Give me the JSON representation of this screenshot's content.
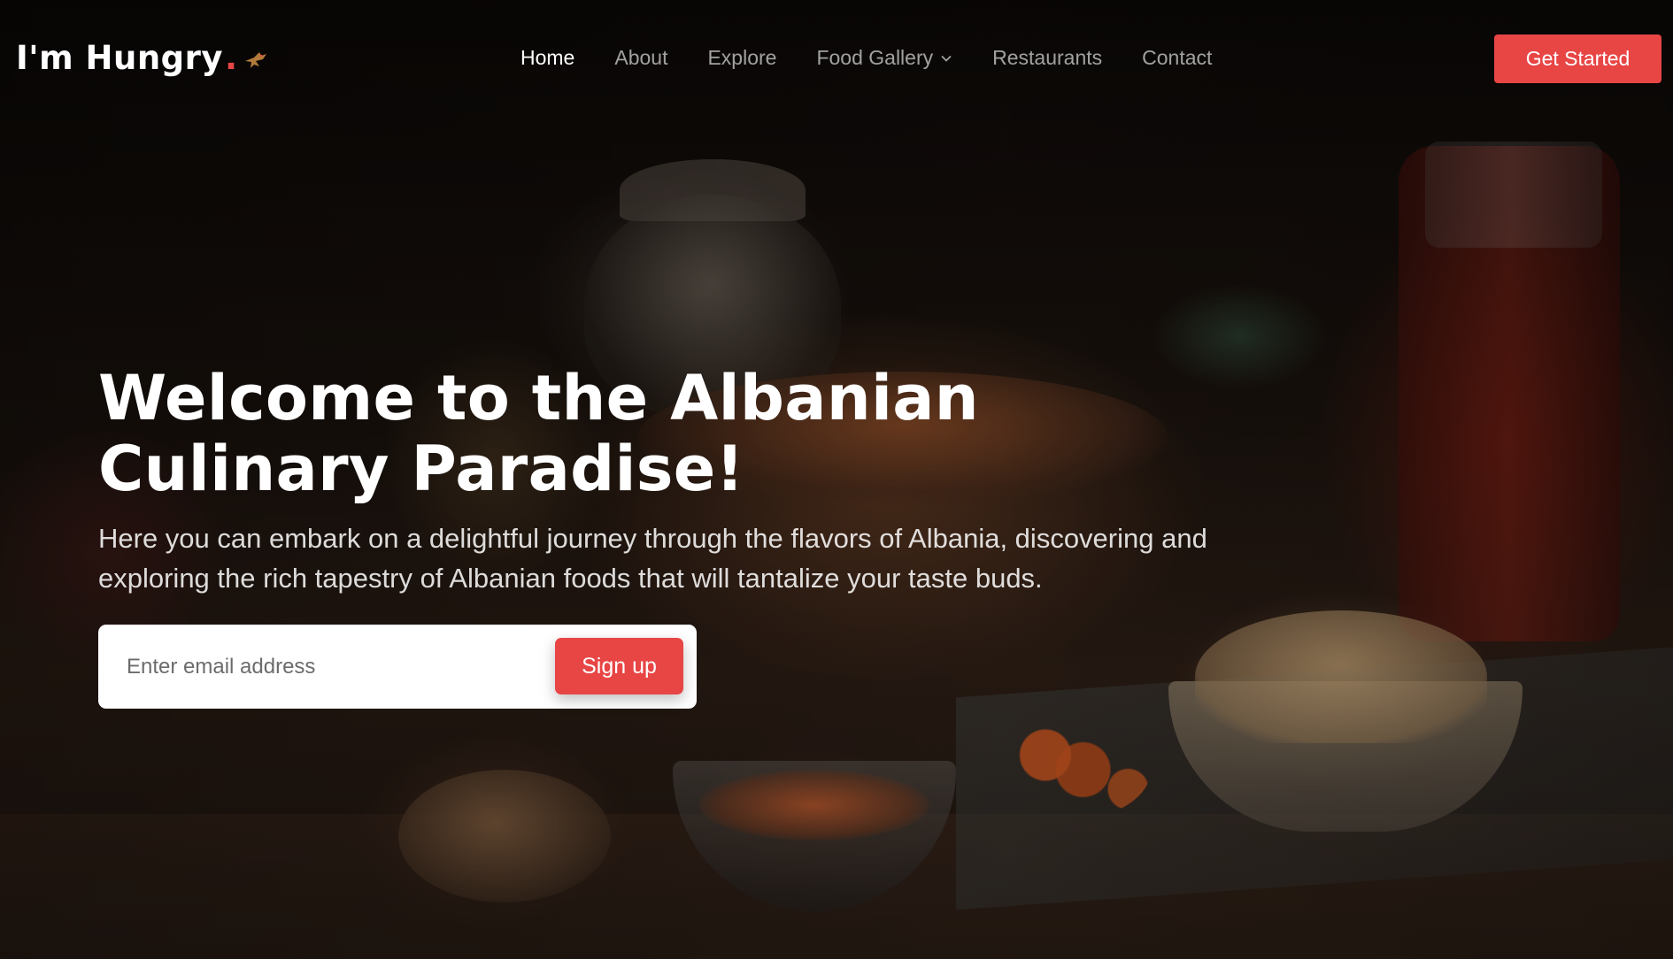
{
  "brand": {
    "name": "I'm Hungry",
    "dot": ".",
    "icon": "bird-icon",
    "accent_color": "#e84545"
  },
  "nav": {
    "items": [
      {
        "label": "Home",
        "active": true
      },
      {
        "label": "About",
        "active": false
      },
      {
        "label": "Explore",
        "active": false
      },
      {
        "label": "Food Gallery",
        "active": false,
        "dropdown": true
      },
      {
        "label": "Restaurants",
        "active": false
      },
      {
        "label": "Contact",
        "active": false
      }
    ],
    "cta_label": "Get Started"
  },
  "hero": {
    "title": "Welcome to the Albanian Culinary Paradise!",
    "subtitle": "Here you can embark on a delightful journey through the flavors of Albania, discovering and exploring the rich tapestry of Albanian foods that will tantalize your taste buds.",
    "email_placeholder": "Enter email address",
    "email_value": "",
    "signup_label": "Sign up"
  }
}
